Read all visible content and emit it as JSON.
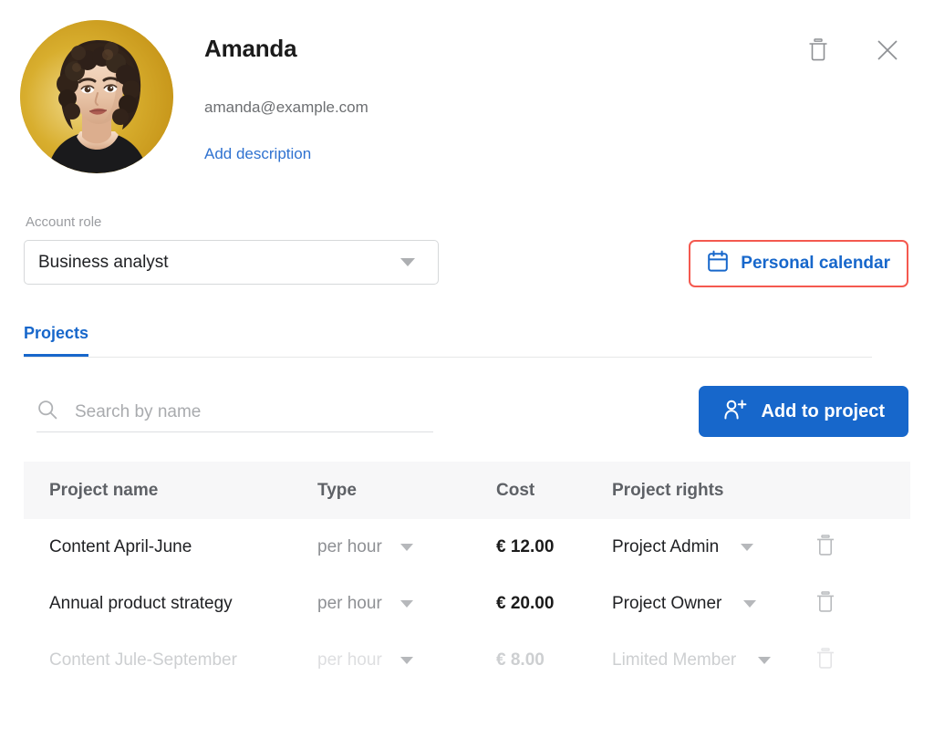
{
  "profile": {
    "name": "Amanda",
    "email": "amanda@example.com",
    "add_description_label": "Add description",
    "avatar_alt": "avatar",
    "delete_icon": "trash-icon",
    "close_icon": "close-icon"
  },
  "account_role": {
    "label": "Account role",
    "selected": "Business analyst"
  },
  "calendar_button": {
    "label": "Personal calendar",
    "icon": "calendar-icon",
    "border_color": "#f4594f",
    "text_color": "#1767cb"
  },
  "tabs": [
    {
      "label": "Projects",
      "active": true
    }
  ],
  "search": {
    "placeholder": "Search by name",
    "value": "",
    "icon": "search-icon"
  },
  "add_button": {
    "label": "Add to project",
    "icon": "person-add-icon",
    "bg_color": "#1767cb"
  },
  "table": {
    "columns": [
      "Project name",
      "Type",
      "Cost",
      "Project rights"
    ],
    "rows": [
      {
        "name": "Content April-June",
        "type": "per hour",
        "cost": "€ 12.00",
        "rights": "Project Admin",
        "disabled": false
      },
      {
        "name": "Annual product strategy",
        "type": "per hour",
        "cost": "€ 20.00",
        "rights": "Project Owner",
        "disabled": false
      },
      {
        "name": "Content Jule-September",
        "type": "per hour",
        "cost": "€ 8.00",
        "rights": "Limited Member",
        "disabled": true
      }
    ]
  }
}
